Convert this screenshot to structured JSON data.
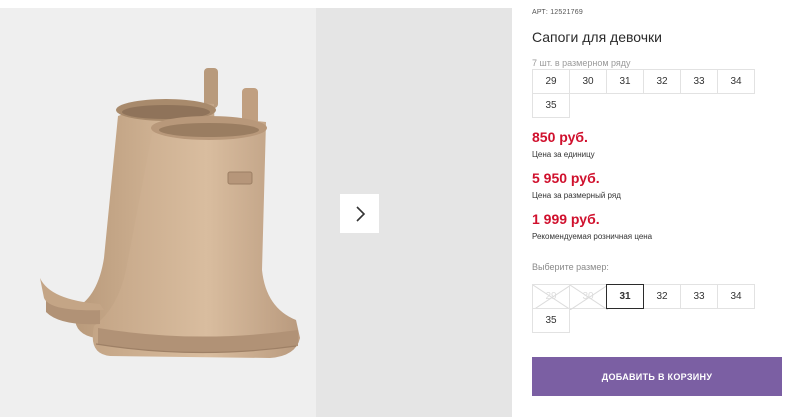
{
  "gallery": {
    "image_alt": "children's beige rubber boots",
    "next_icon": "chevron-right-icon"
  },
  "product": {
    "article_prefix": "АРТ:",
    "article_number": "12521769",
    "title": "Сапоги для девочки"
  },
  "pack": {
    "label": "7 шт. в размерном ряду",
    "sizes": [
      "29",
      "30",
      "31",
      "32",
      "33",
      "34",
      "35"
    ]
  },
  "prices": [
    {
      "amount": "850 руб.",
      "note": "Цена за единицу"
    },
    {
      "amount": "5 950 руб.",
      "note": "Цена за размерный ряд"
    },
    {
      "amount": "1 999 руб.",
      "note": "Рекомендуемая розничная цена"
    }
  ],
  "size_select": {
    "label": "Выберите размер:",
    "options": [
      {
        "size": "29",
        "state": "disabled"
      },
      {
        "size": "30",
        "state": "disabled"
      },
      {
        "size": "31",
        "state": "selected"
      },
      {
        "size": "32",
        "state": "available"
      },
      {
        "size": "33",
        "state": "available"
      },
      {
        "size": "34",
        "state": "available"
      },
      {
        "size": "35",
        "state": "available"
      }
    ]
  },
  "cart": {
    "button_label": "ДОБАВИТЬ В КОРЗИНУ"
  },
  "colors": {
    "price": "#d0102d",
    "button": "#7b5fa3",
    "boot": "#c9ab8c"
  }
}
